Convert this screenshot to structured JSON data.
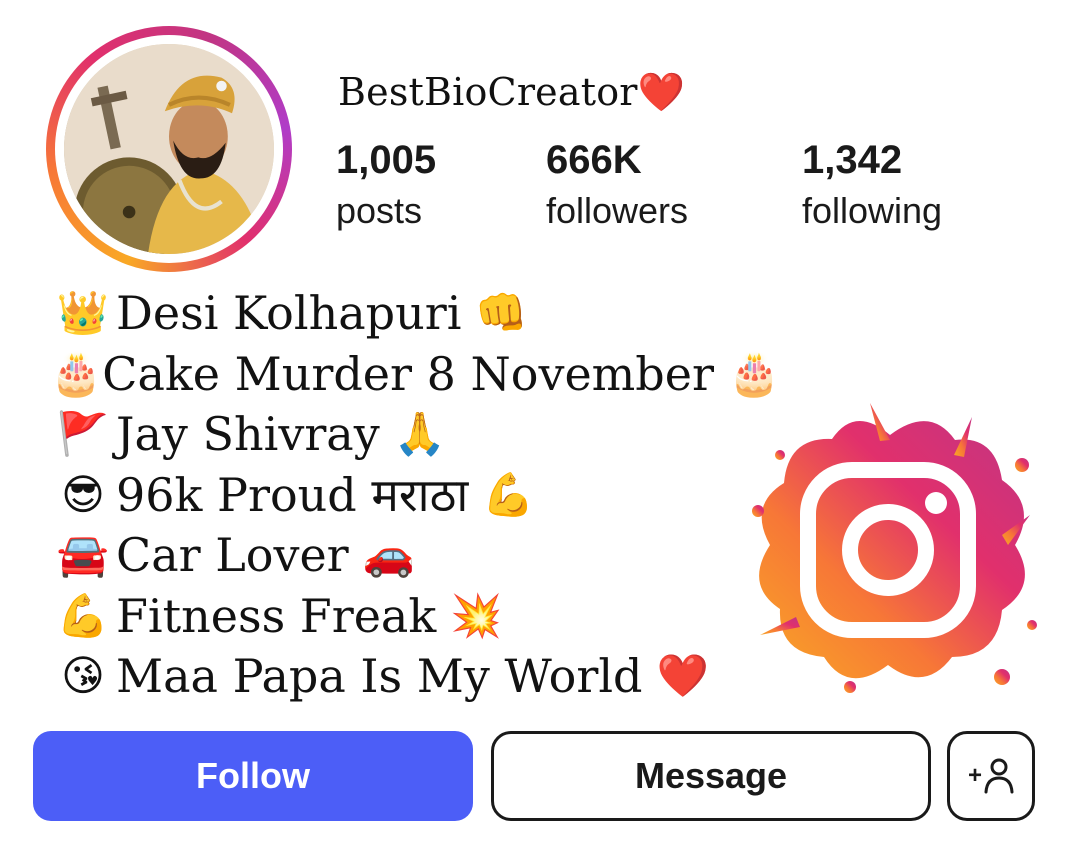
{
  "profile": {
    "username": "BestBioCreator",
    "username_heart": "❤️",
    "avatar_description_icon": "warrior-avatar"
  },
  "stats": {
    "posts": {
      "value": "1,005",
      "label": "posts"
    },
    "followers": {
      "value": "666K",
      "label": "followers"
    },
    "following": {
      "value": "1,342",
      "label": "following"
    }
  },
  "bio": [
    {
      "emoji": "👑",
      "text": "Desi Kolhapuri",
      "emoji_after": "👊"
    },
    {
      "emoji": "🎂",
      "text": "Cake Murder 8 November",
      "emoji_after": "🎂"
    },
    {
      "emoji": "🚩",
      "text": "Jay Shivray",
      "emoji_after": "🙏"
    },
    {
      "emoji": "😎",
      "text": "96k Proud मराठा",
      "emoji_after": "💪"
    },
    {
      "emoji": "🚘",
      "text": "Car Lover",
      "emoji_after": "🚗"
    },
    {
      "emoji": "💪",
      "text": "Fitness Freak",
      "emoji_after": "💥"
    },
    {
      "emoji": "😘",
      "text": "Maa Papa Is My World",
      "emoji_after": "❤️"
    }
  ],
  "actions": {
    "follow_label": "Follow",
    "message_label": "Message",
    "add_user_glyph": "+"
  },
  "colors": {
    "follow_button": "#4c5ef7",
    "heart": "#f0334f",
    "insta_gradient": [
      "#f9a825",
      "#f77737",
      "#e1306c",
      "#c13584"
    ]
  },
  "icons": {
    "logo": "instagram-logo-icon",
    "add_user": "add-user-icon"
  }
}
